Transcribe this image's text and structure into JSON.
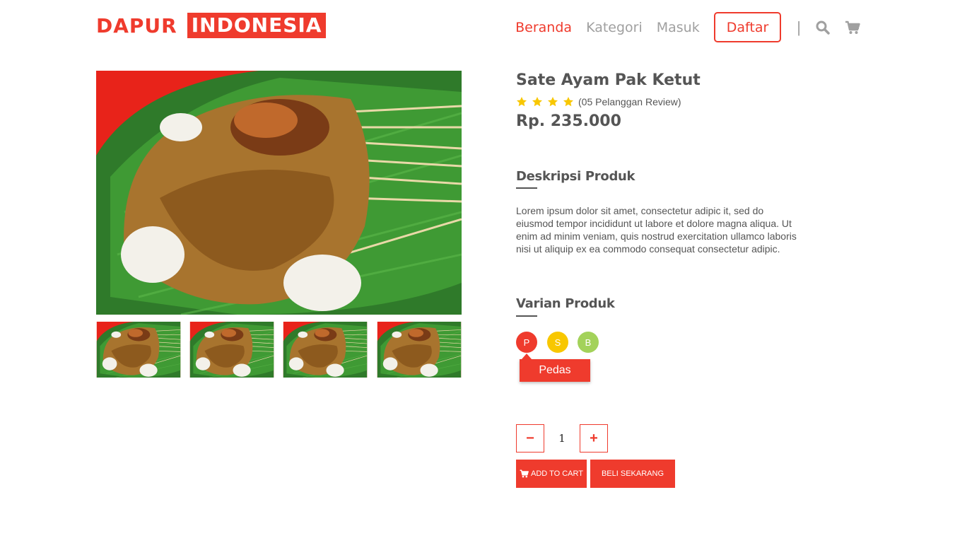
{
  "brand": {
    "part1": "DAPUR",
    "part2": "INDONESIA"
  },
  "nav": {
    "links": [
      "Beranda",
      "Kategori",
      "Masuk"
    ],
    "signup": "Daftar",
    "separator": "|",
    "icons": [
      "search-icon",
      "cart-icon"
    ]
  },
  "product": {
    "name": "Sate Ayam Pak Ketut",
    "rating": 4,
    "review_text": "(05 Pelanggan Review)",
    "price": "Rp. 235.000",
    "description_title": "Deskripsi Produk",
    "description": "Lorem ipsum dolor sit amet, consectetur adipic it, sed do eiusmod tempor incididunt ut labore et dolore magna aliqua. Ut enim ad minim veniam, quis nostrud exercitation ullamco laboris nisi ut aliquip ex ea commodo consequat consectetur adipic.",
    "variant_title": "Varian Produk",
    "variants": [
      {
        "code": "P",
        "color": "#ef3b2d"
      },
      {
        "code": "S",
        "color": "#f8c700"
      },
      {
        "code": "B",
        "color": "#a3d25a"
      }
    ],
    "variant_tooltip": "Pedas",
    "quantity": "1",
    "minus": "−",
    "plus": "+",
    "add_to_cart": "ADD TO CART",
    "buy_now": "BELI SEKARANG"
  },
  "colors": {
    "accent": "#ef3b2d",
    "text": "#555555",
    "muted": "#a0a0a0",
    "star": "#f8c700"
  }
}
